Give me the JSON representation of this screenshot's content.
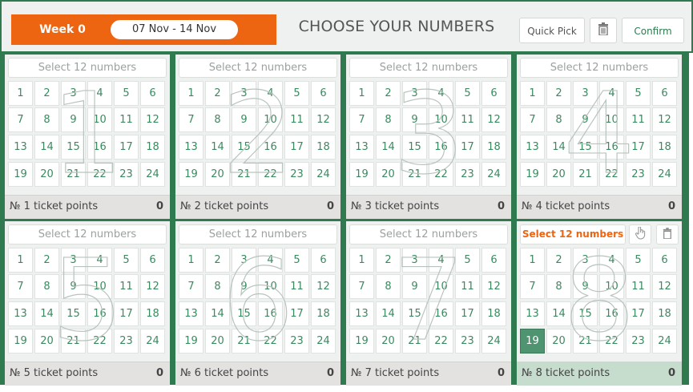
{
  "header": {
    "week_label": "Week 0",
    "date_range": "07 Nov - 14 Nov",
    "title": "CHOOSE YOUR NUMBERS",
    "quick_pick_label": "Quick Pick",
    "confirm_label": "Confirm",
    "trash_icon": "trash-icon"
  },
  "colors": {
    "brand_orange": "#ee6511",
    "brand_green": "#2f7a4f",
    "number_green": "#3b8a5f"
  },
  "tickets": [
    {
      "select_label": "Select 12 numbers",
      "points_label": "№ 1 ticket points",
      "points": "0",
      "big_digit": "1",
      "selected": []
    },
    {
      "select_label": "Select 12 numbers",
      "points_label": "№ 2 ticket points",
      "points": "0",
      "big_digit": "2",
      "selected": []
    },
    {
      "select_label": "Select 12 numbers",
      "points_label": "№ 3 ticket points",
      "points": "0",
      "big_digit": "3",
      "selected": []
    },
    {
      "select_label": "Select 12 numbers",
      "points_label": "№ 4 ticket points",
      "points": "0",
      "big_digit": "4",
      "selected": []
    },
    {
      "select_label": "Select 12 numbers",
      "points_label": "№ 5 ticket points",
      "points": "0",
      "big_digit": "5",
      "selected": []
    },
    {
      "select_label": "Select 12 numbers",
      "points_label": "№ 6 ticket points",
      "points": "0",
      "big_digit": "6",
      "selected": []
    },
    {
      "select_label": "Select 12 numbers",
      "points_label": "№ 7 ticket points",
      "points": "0",
      "big_digit": "7",
      "selected": []
    },
    {
      "select_label": "Select 12 numbers",
      "points_label": "№ 8 ticket points",
      "points": "0",
      "big_digit": "8",
      "selected": [
        19
      ],
      "active": true,
      "tools": [
        "hand-pointer-icon",
        "trash-icon"
      ]
    }
  ],
  "numbers": [
    "1",
    "2",
    "3",
    "4",
    "5",
    "6",
    "7",
    "8",
    "9",
    "10",
    "11",
    "12",
    "13",
    "14",
    "15",
    "16",
    "17",
    "18",
    "19",
    "20",
    "21",
    "22",
    "23",
    "24"
  ]
}
